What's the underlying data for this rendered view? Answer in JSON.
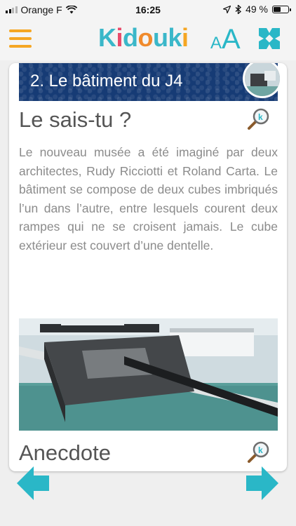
{
  "status_bar": {
    "carrier": "Orange F",
    "time": "16:25",
    "battery": "49 %",
    "battery_level": 0.49
  },
  "header": {
    "logo": "Kidouki",
    "text_size_small": "A",
    "text_size_large": "A",
    "colors": {
      "accent_orange": "#f5a623",
      "accent_teal": "#2ab7c7"
    }
  },
  "card": {
    "banner_title": "2. Le bâtiment du J4",
    "section_title": "Le sais-tu ?",
    "body": "Le nouveau musée a été imaginé par deux architectes, Rudy Ricciotti et Roland Carta. Le bâtiment se compose de deux cubes imbriqués l’un dans l’autre, entre lesquels courent deux rampes qui ne se croisent jamais. Le cube extérieur est couvert d’une dentelle.",
    "section_title_2": "Anecdote"
  }
}
